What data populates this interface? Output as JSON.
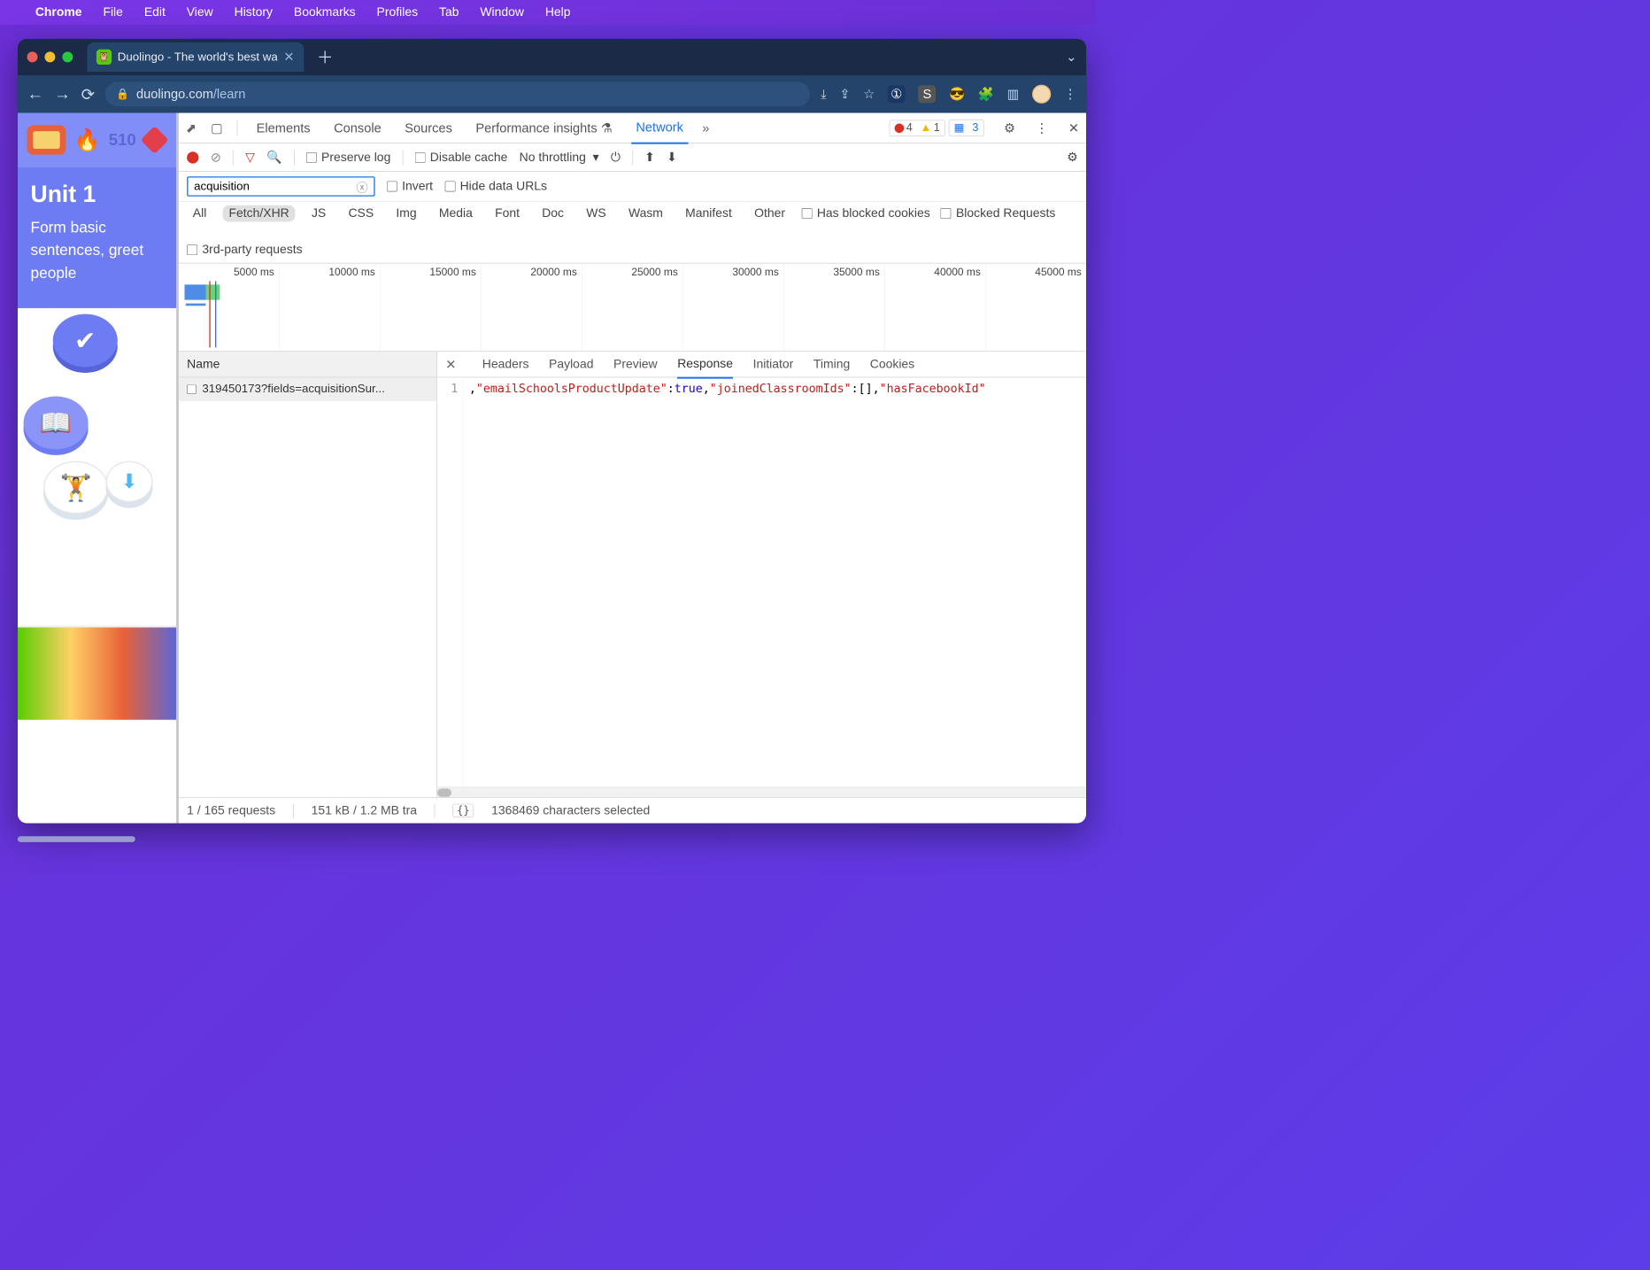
{
  "menubar": {
    "app": "Chrome",
    "items": [
      "File",
      "Edit",
      "View",
      "History",
      "Bookmarks",
      "Profiles",
      "Tab",
      "Window",
      "Help"
    ]
  },
  "chrome": {
    "tab_title": "Duolingo - The world's best wa",
    "url_host": "duolingo.com",
    "url_path": "/learn"
  },
  "duolingo": {
    "streak": "510",
    "unit_title": "Unit 1",
    "unit_desc": "Form basic sentences, greet people"
  },
  "devtools": {
    "tabs": {
      "elements": "Elements",
      "console": "Console",
      "sources": "Sources",
      "perf": "Performance insights",
      "network": "Network"
    },
    "counts": {
      "errors": "4",
      "warnings": "1",
      "messages": "3"
    },
    "toolbar": {
      "preserve_log": "Preserve log",
      "disable_cache": "Disable cache",
      "throttle": "No throttling"
    },
    "filter": {
      "value": "acquisition",
      "invert": "Invert",
      "hide_data": "Hide data URLs"
    },
    "type_filter": {
      "all": "All",
      "fetchxhr": "Fetch/XHR",
      "js": "JS",
      "css": "CSS",
      "img": "Img",
      "media": "Media",
      "font": "Font",
      "doc": "Doc",
      "ws": "WS",
      "wasm": "Wasm",
      "manifest": "Manifest",
      "other": "Other",
      "has_blocked": "Has blocked cookies",
      "blocked_req": "Blocked Requests",
      "third_party": "3rd-party requests"
    },
    "timeline_ticks": [
      "5000 ms",
      "10000 ms",
      "15000 ms",
      "20000 ms",
      "25000 ms",
      "30000 ms",
      "35000 ms",
      "40000 ms",
      "45000 ms"
    ],
    "reqlist": {
      "header": "Name",
      "rows": [
        "319450173?fields=acquisitionSur..."
      ]
    },
    "detail_tabs": {
      "headers": "Headers",
      "payload": "Payload",
      "preview": "Preview",
      "response": "Response",
      "initiator": "Initiator",
      "timing": "Timing",
      "cookies": "Cookies"
    },
    "response": {
      "line_no": "1",
      "k1": "\"emailSchoolsProductUpdate\"",
      "v1": "true",
      "k2": "\"joinedClassroomIds\"",
      "v2": "[]",
      "k3": "\"hasFacebookId\""
    },
    "status": {
      "requests": "1 / 165 requests",
      "transfer": "151 kB / 1.2 MB tra",
      "selection": "1368469 characters selected"
    }
  }
}
